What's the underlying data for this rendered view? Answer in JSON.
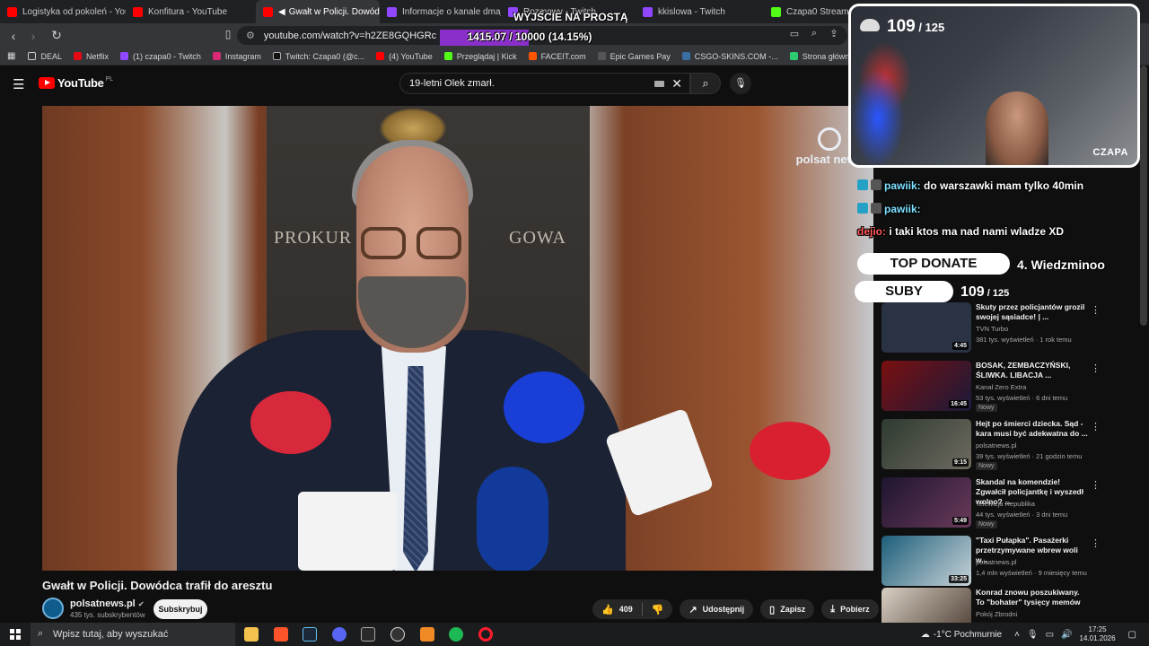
{
  "browser": {
    "tabs": [
      {
        "label": "Logistyka od pokoleń - YouTube",
        "color": "#ff0000",
        "active": false
      },
      {
        "label": "Konfitura - YouTube",
        "color": "#ff0000",
        "active": false
      },
      {
        "label": "Gwałt w Policji. Dowódc",
        "color": "#ff0000",
        "active": true
      },
      {
        "label": "Informacje o kanale dmajszi - T",
        "color": "#9146ff",
        "active": false
      },
      {
        "label": "Rozmowy - Twitch",
        "color": "#9146ff",
        "active": false
      },
      {
        "label": "kkislowa - Twitch",
        "color": "#9146ff",
        "active": false
      },
      {
        "label": "Czapa0 Stream - W",
        "color": "#53fc18",
        "active": false
      }
    ],
    "url": "youtube.com/watch?v=h2ZE8GQHGRc",
    "bookmarks": [
      {
        "label": "DEAL",
        "color": "#cccccc"
      },
      {
        "label": "Netflix",
        "color": "#e50914"
      },
      {
        "label": "(1) czapa0 - Twitch",
        "color": "#9146ff"
      },
      {
        "label": "Instagram",
        "color": "#d62976"
      },
      {
        "label": "Twitch: Czapa0 (@c...",
        "color": "#111111"
      },
      {
        "label": "(4) YouTube",
        "color": "#ff0000"
      },
      {
        "label": "Przeglądaj | Kick",
        "color": "#53fc18"
      },
      {
        "label": "FACEIT.com",
        "color": "#ff5500"
      },
      {
        "label": "Epic Games Pay",
        "color": "#333333"
      },
      {
        "label": "CSGO-SKINS.COM -...",
        "color": "#3a6ea5"
      },
      {
        "label": "Strona główna - CSI...",
        "color": "#2ecc71"
      }
    ]
  },
  "youtube": {
    "logo": "YouTube",
    "region": "PL",
    "search_value": "19-letni Olek zmarł.",
    "video": {
      "title": "Gwałt w Policji. Dowódca trafił do aresztu",
      "sign_left": "PROKUR",
      "sign_right": "GOWA",
      "watermark": "polsat news"
    },
    "channel": {
      "name": "polsatnews.pl",
      "subs": "435 tys. subskrybentów",
      "subscribe": "Subskrybuj"
    },
    "actions": {
      "likes": "409",
      "share": "Udostępnij",
      "save": "Zapisz",
      "download": "Pobierz"
    },
    "recommendations": [
      {
        "title": "Skuty przez policjantów grozil swojej sąsiadce! | ...",
        "channel": "TVN Turbo",
        "meta": "381 tys. wyświetleń · 1 rok temu",
        "duration": "4:45",
        "new": "",
        "thumb": "#2a3344"
      },
      {
        "title": "BOSAK, ZEMBACZYŃSKI, ŚLIWKA. LIBACJA ...",
        "channel": "Kanał Zero Extra",
        "meta": "53 tys. wyświetleń · 6 dni temu",
        "duration": "16:45",
        "new": "Nowy",
        "thumb": "#5a1a1a"
      },
      {
        "title": "Hejt po śmierci dziecka. Sąd - kara musi być adekwatna do ...",
        "channel": "polsatnews.pl",
        "meta": "39 tys. wyświetleń · 21 godzin temu",
        "duration": "9:15",
        "new": "Nowy",
        "thumb": "#3b4a3e"
      },
      {
        "title": "Skandal na komendzie! Zgwałcił policjantkę i wyszedł wolno? ...",
        "channel": "Telewizja Republika",
        "meta": "44 tys. wyświetleń · 3 dni temu",
        "duration": "5:49",
        "new": "Nowy",
        "thumb": "#3a2a44"
      },
      {
        "title": "\"Taxi Pułapka\". Pasażerki przetrzymywane wbrew woli w...",
        "channel": "polsatnews.pl",
        "meta": "1,4 mln wyświetleń · 9 miesięcy temu",
        "duration": "33:25",
        "new": "",
        "thumb": "#2d5d6a"
      },
      {
        "title": "Konrad znowu poszukiwany. To \"bohater\" tysięcy memów",
        "channel": "Pokój Zbrodni",
        "meta": "",
        "duration": "",
        "new": "",
        "thumb": "#4a3a30"
      }
    ]
  },
  "overlay": {
    "goal_label": "WYJŚCIE NA PROSTĄ",
    "goal_progress": "1415.07 / 10000 (14.15%)",
    "goal_fraction": 0.1415,
    "cam_count": "109",
    "cam_goal": "125",
    "cam_name": "CZAPA",
    "chat": [
      {
        "user": "pawiik:",
        "msg": "do warszawki mam tylko 40min"
      },
      {
        "user": "pawiik:",
        "msg": ""
      },
      {
        "user": "dejio:",
        "msg": "i taki ktos ma nad nami wladze XD"
      }
    ],
    "top_donate": "TOP DONATE",
    "top_donate_name": "4. Wiedzminoo",
    "suby_label": "SUBY",
    "sub_count": "109",
    "sub_goal": "125"
  },
  "taskbar": {
    "search_placeholder": "Wpisz tutaj, aby wyszukać",
    "weather": "-1°C  Pochmurnie",
    "time": "17:25",
    "date": "14.01.2026"
  }
}
